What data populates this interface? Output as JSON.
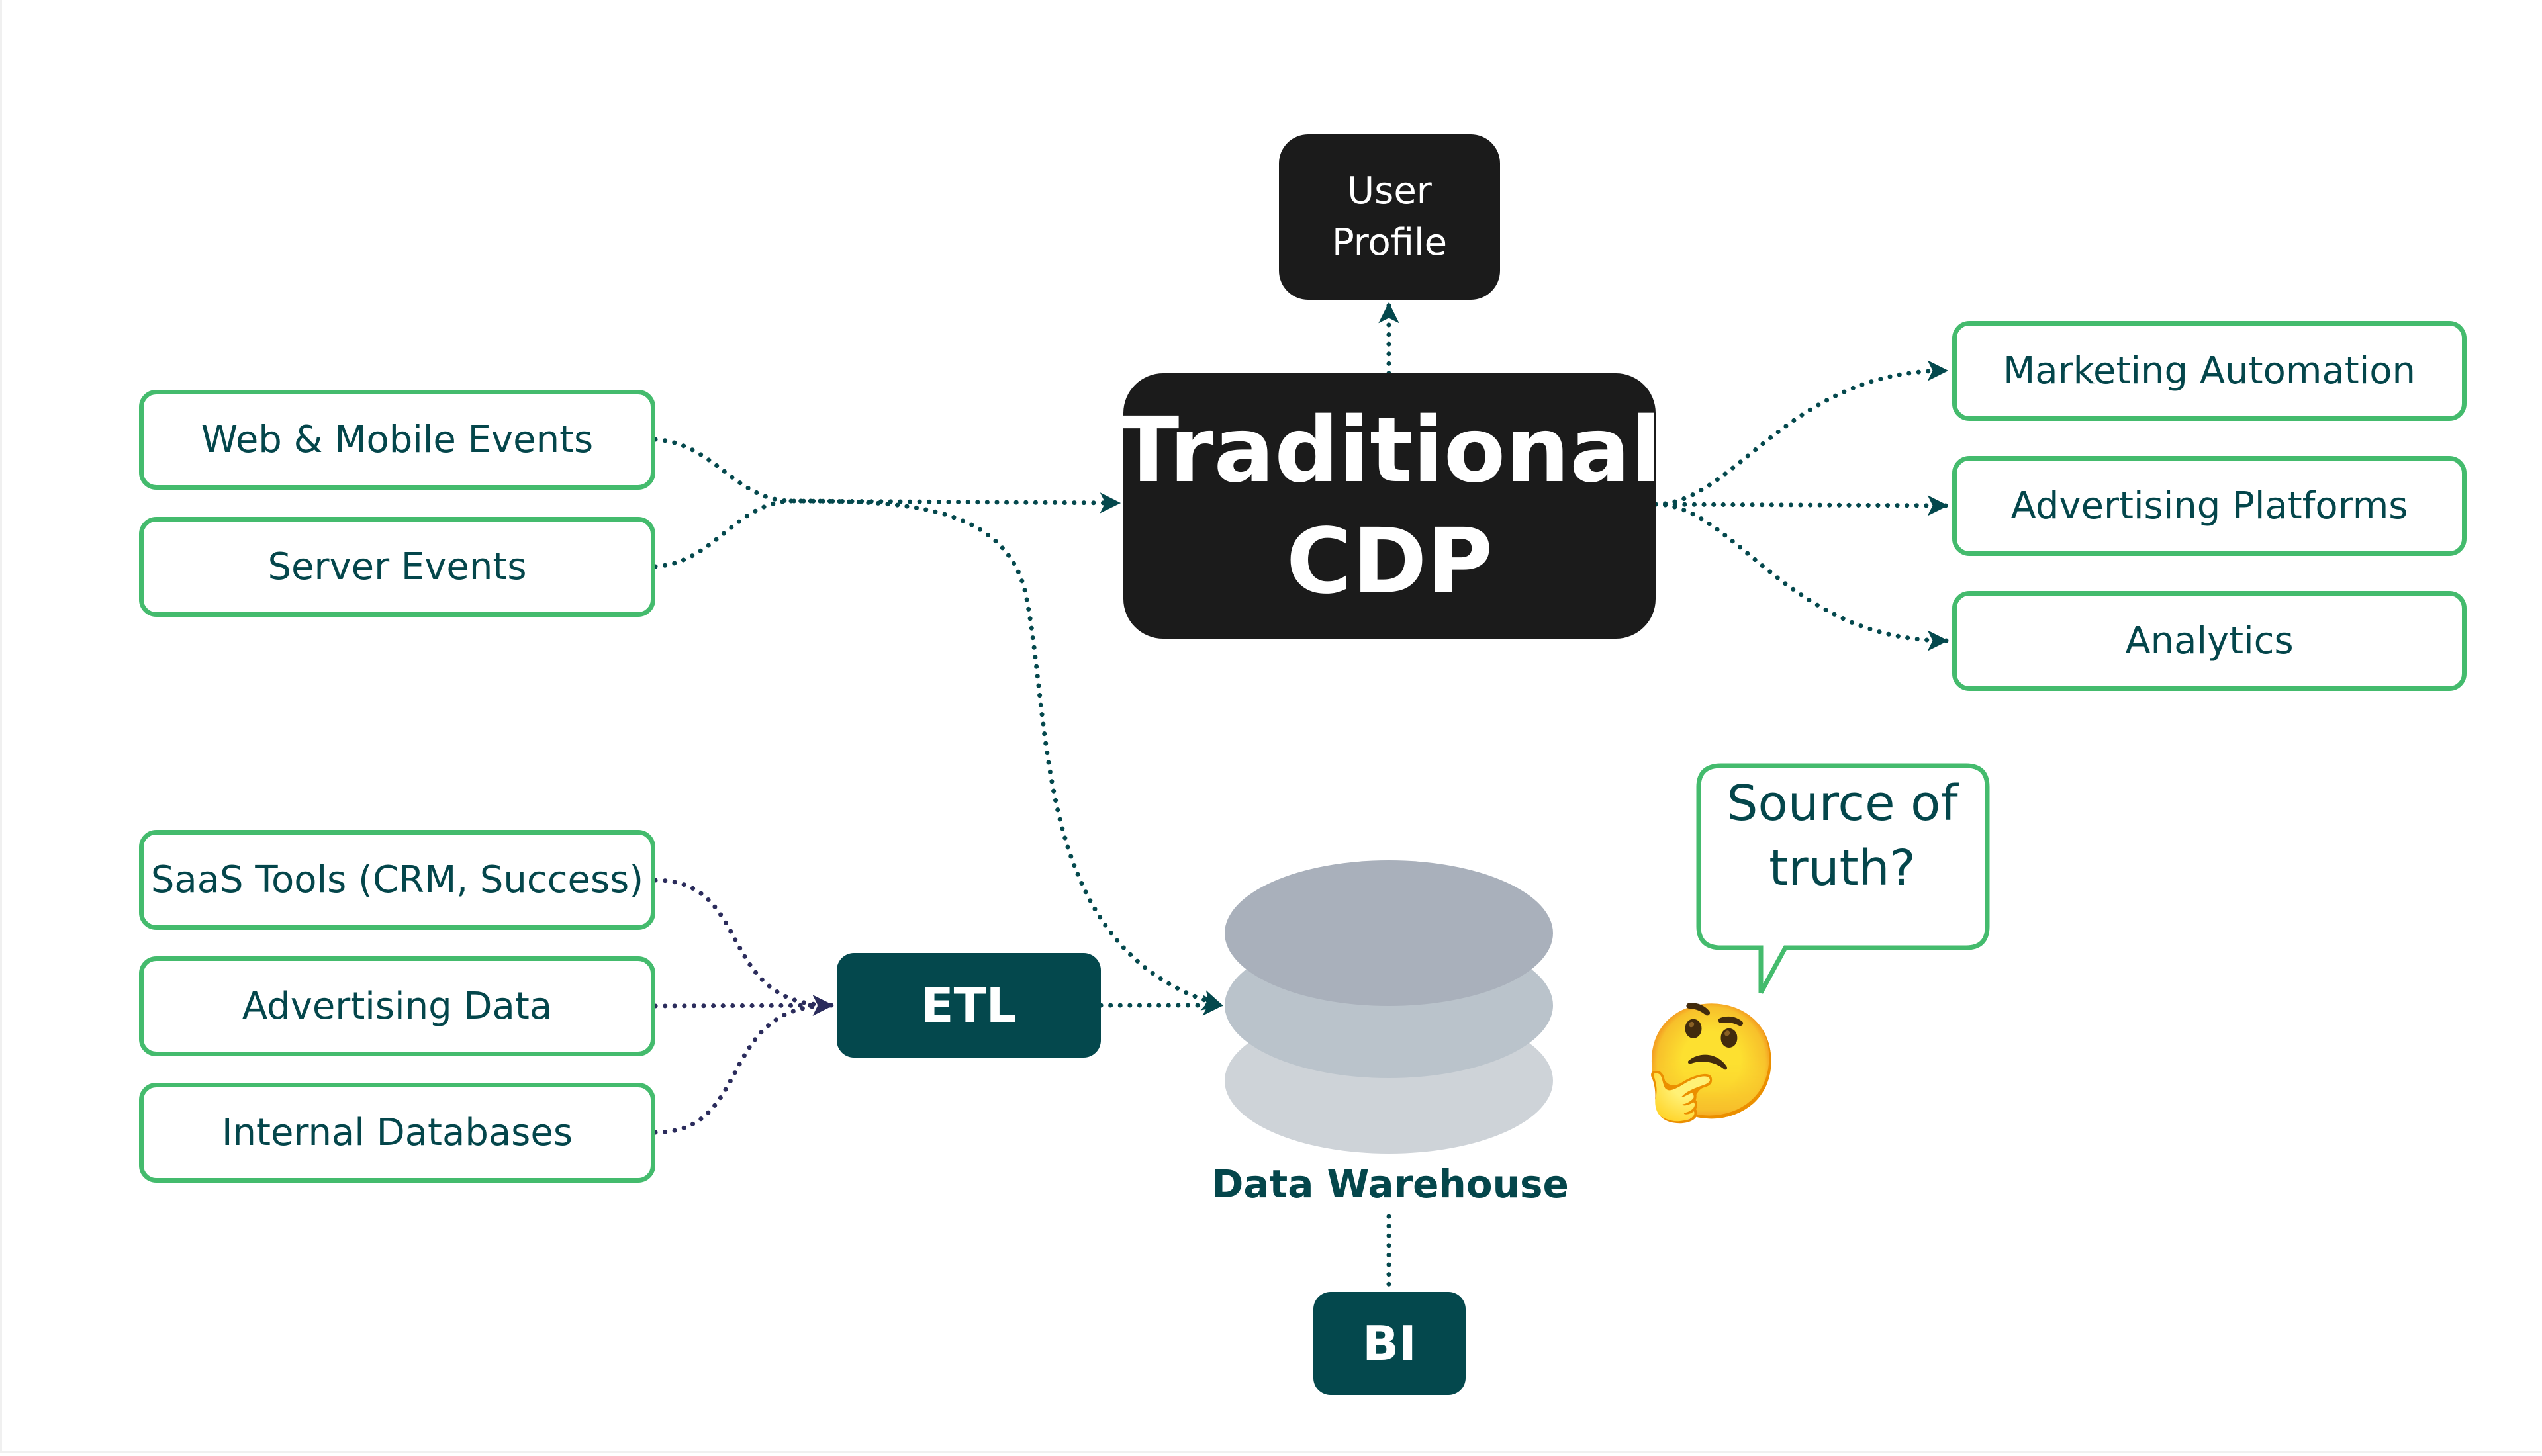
{
  "diagram": {
    "central": {
      "line1": "Traditional",
      "line2": "CDP"
    },
    "user_profile": {
      "line1": "User",
      "line2": "Profile"
    },
    "event_sources": [
      {
        "label": "Web & Mobile Events"
      },
      {
        "label": "Server Events"
      }
    ],
    "etl_sources": [
      {
        "label": "SaaS Tools (CRM, Success)"
      },
      {
        "label": "Advertising Data"
      },
      {
        "label": "Internal Databases"
      }
    ],
    "destinations": [
      {
        "label": "Marketing Automation"
      },
      {
        "label": "Advertising Platforms"
      },
      {
        "label": "Analytics"
      }
    ],
    "etl": {
      "label": "ETL"
    },
    "warehouse": {
      "label": "Data Warehouse",
      "icon": "database-icon"
    },
    "bi": {
      "label": "BI"
    },
    "callout": {
      "line1": "Source of",
      "line2": "truth?"
    },
    "emoji": {
      "name": "thinking-face",
      "glyph": "🤔"
    }
  },
  "colors": {
    "node_border": "#44bb6d",
    "node_text": "#04464b",
    "central_fill": "#1b1b1b",
    "teal_fill": "#04484d",
    "link_teal": "#04484d",
    "link_navy": "#2b2c5c",
    "db_top": "#a9b0bb",
    "db_middle": "#bac3cb",
    "db_bottom": "#ced3d8"
  }
}
